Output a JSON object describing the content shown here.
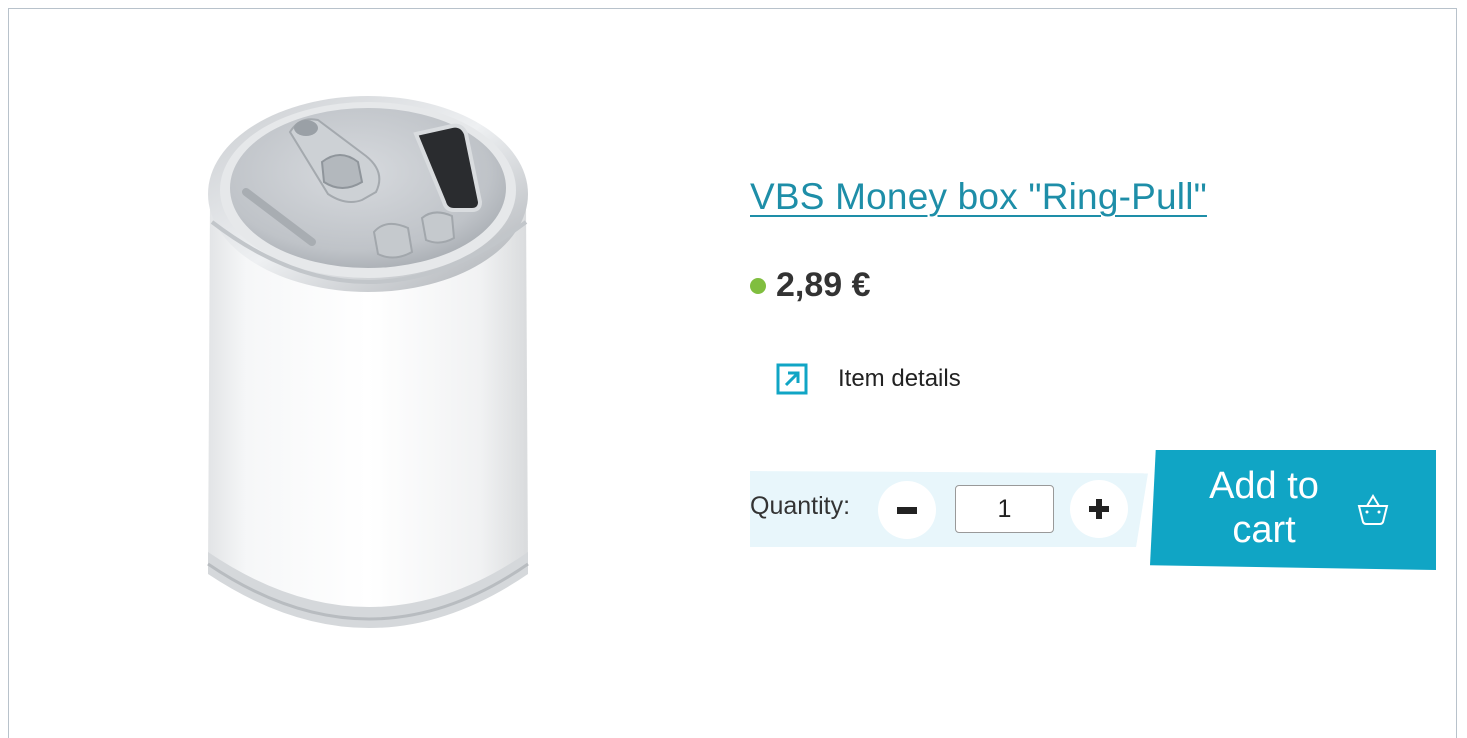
{
  "product": {
    "title": "VBS Money box \"Ring-Pull\"",
    "price": "2,89 €",
    "availability_color": "#80be3f",
    "image_icon": "tin-can-money-box-image"
  },
  "details_link": {
    "label": "Item details",
    "icon": "external-arrow-icon"
  },
  "quantity": {
    "label": "Quantity:",
    "value": "1",
    "decrement_icon": "minus-icon",
    "increment_icon": "plus-icon"
  },
  "add_to_cart": {
    "label": "Add to cart",
    "icon": "basket-icon"
  },
  "colors": {
    "link": "#1e8ea8",
    "accent": "#10a5c5",
    "quantity_band": "#e8f6fb"
  }
}
